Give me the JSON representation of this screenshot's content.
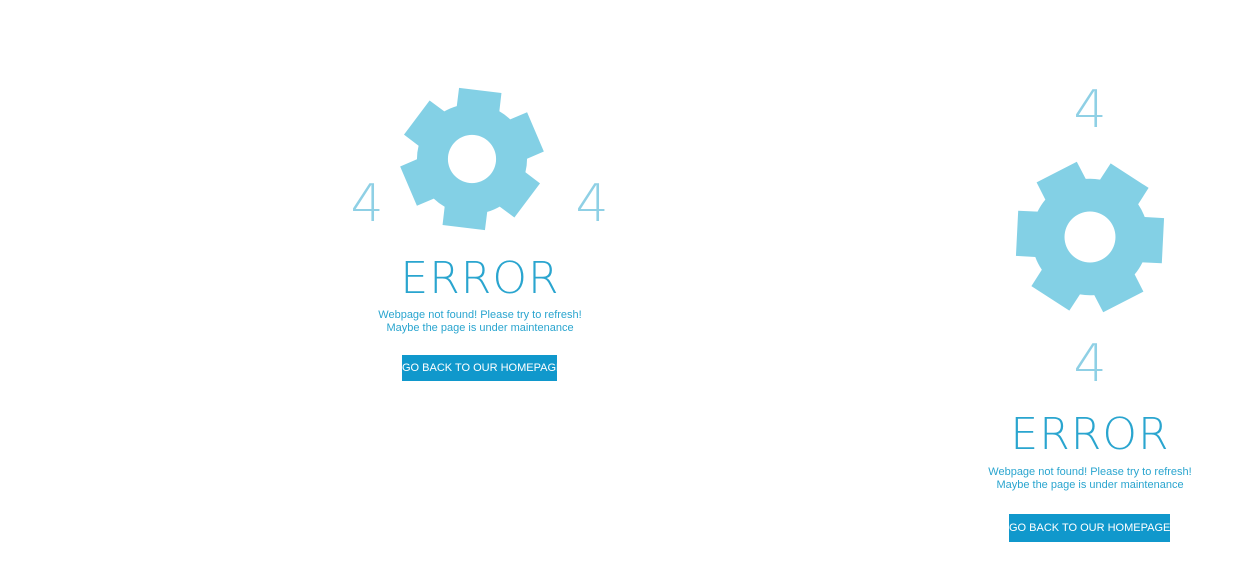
{
  "colors": {
    "gear": "#83d0e5",
    "digit": "#8fd0e5",
    "title": "#2aa5cf",
    "button_bg": "#1098cc",
    "button_text": "#ffffff"
  },
  "panels": [
    {
      "digit_left": "4",
      "digit_right": "4",
      "icon": "gear-icon",
      "title": "ERROR",
      "message_line1": "Webpage not found! Please try to refresh!",
      "message_line2": "Maybe the page is under maintenance",
      "button_label": "GO BACK TO OUR HOMEPAGE"
    },
    {
      "digit_top": "4",
      "digit_bottom": "4",
      "icon": "gear-icon",
      "title": "ERROR",
      "message_line1": "Webpage not found! Please try to refresh!",
      "message_line2": "Maybe the page is under maintenance",
      "button_label": "GO BACK TO OUR HOMEPAGE"
    }
  ]
}
